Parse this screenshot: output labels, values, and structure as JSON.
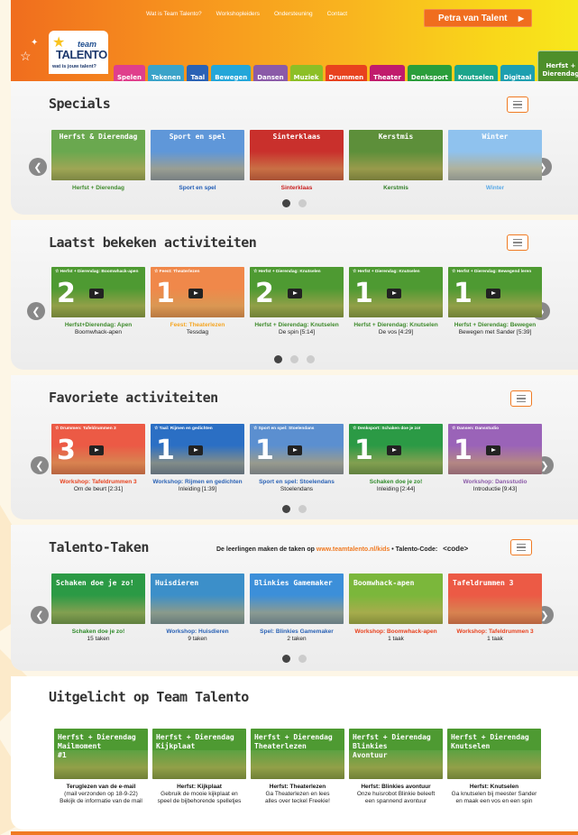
{
  "header": {
    "topnav": [
      "Wat is Team Talento?",
      "Workshopleiders",
      "Ondersteuning",
      "Contact"
    ],
    "user_button": "Petra van Talent",
    "logo": {
      "line1": "team",
      "line2": "TALENTO",
      "tagline": "wat is jouw talent?"
    },
    "tabs": [
      {
        "label": "Spelen",
        "color": "#e03f8c"
      },
      {
        "label": "Tekenen",
        "color": "#3aa3c9"
      },
      {
        "label": "Taal",
        "color": "#2a62b5"
      },
      {
        "label": "Bewegen",
        "color": "#23a6d9"
      },
      {
        "label": "Dansen",
        "color": "#8b5aa8"
      },
      {
        "label": "Muziek",
        "color": "#8cbf26"
      },
      {
        "label": "Drummen",
        "color": "#e8421e"
      },
      {
        "label": "Theater",
        "color": "#c11b6c"
      },
      {
        "label": "Denksport",
        "color": "#2a9e3b"
      },
      {
        "label": "Knutselen",
        "color": "#1ca58b"
      },
      {
        "label": "Digitaal",
        "color": "#1d9fb0"
      }
    ],
    "special_tab": {
      "line1": "Herfst +",
      "line2": "Dierendag",
      "color": "#4e8f2a"
    }
  },
  "sections": {
    "specials": {
      "title": "Specials",
      "cards": [
        {
          "thumb_title": "Herfst & Dierendag",
          "label": "Herfst + Dierendag",
          "color": "#3e8a2c",
          "bg": "#6aa84f"
        },
        {
          "thumb_title": "Sport en spel",
          "label": "Sport en spel",
          "color": "#1f5bb5",
          "bg": "#5f97d9"
        },
        {
          "thumb_title": "Sinterklaas",
          "label": "Sinterklaas",
          "color": "#c81d1d",
          "bg": "#c9302c"
        },
        {
          "thumb_title": "Kerstmis",
          "label": "Kerstmis",
          "color": "#2f7d25",
          "bg": "#5d8f3a"
        },
        {
          "thumb_title": "Winter",
          "label": "Winter",
          "color": "#5aa9e6",
          "bg": "#8fc2ee"
        }
      ]
    },
    "recent": {
      "title": "Laatst bekeken activiteiten",
      "cards": [
        {
          "sub": "☆ Herfst + Dierendag: Boomwhack-apen",
          "num": "2",
          "label": "Herfst+Dierendag: Apen",
          "detail": "Boomwhack-apen",
          "color": "#3e8a2c",
          "bg": "#4e9a32"
        },
        {
          "sub": "☆ Feest: Theaterlezen",
          "num": "1",
          "label": "Feest: Theaterlezen",
          "detail": "Tessdag",
          "color": "#f5a623",
          "bg": "#f0884a"
        },
        {
          "sub": "☆ Herfst + Dierendag: Knutselen",
          "num": "2",
          "label": "Herfst + Dierendag: Knutselen",
          "detail": "De spin [5:14]",
          "color": "#3e8a2c",
          "bg": "#4e9a32"
        },
        {
          "sub": "☆ Herfst + Dierendag: Knutselen",
          "num": "1",
          "label": "Herfst + Dierendag: Knutselen",
          "detail": "De vos [4:29]",
          "color": "#3e8a2c",
          "bg": "#4e9a32"
        },
        {
          "sub": "☆ Herfst + Dierendag: Bewegend leren",
          "num": "1",
          "label": "Herfst + Dierendag: Bewegen",
          "detail": "Bewegen met Sander [5:39]",
          "color": "#3e8a2c",
          "bg": "#4e9a32"
        }
      ]
    },
    "favorites": {
      "title": "Favoriete activiteiten",
      "cards": [
        {
          "sub": "☆ Drummen: Tafeldrummen 3",
          "num": "3",
          "label": "Workshop: Tafeldrummen 3",
          "detail": "Om de beurt [2:31]",
          "color": "#e8421e",
          "bg": "#ec5a45"
        },
        {
          "sub": "☆ Taal: Rijmen en gedichten",
          "num": "1",
          "label": "Workshop: Rijmen en gedichten",
          "detail": "Inleiding [1:39]",
          "color": "#2a62b5",
          "bg": "#2b6fc4"
        },
        {
          "sub": "☆ Sport en spel: Stoelendans",
          "num": "1",
          "label": "Sport en spel: Stoelendans",
          "detail": "Stoelendans",
          "color": "#2a62b5",
          "bg": "#5b8fd0"
        },
        {
          "sub": "☆ Denksport: Schaken doe je zo!",
          "num": "1",
          "label": "Schaken doe je zo!",
          "detail": "Inleiding [2:44]",
          "color": "#2f8a2a",
          "bg": "#2b9a45"
        },
        {
          "sub": "☆ Dansen: Dansstudio",
          "num": "1",
          "label": "Workshop: Dansstudio",
          "detail": "Introductie [9:43]",
          "color": "#8b5aa8",
          "bg": "#9a63b8"
        }
      ]
    },
    "tasks": {
      "title": "Talento-Taken",
      "info_text": "De leerlingen maken de taken op",
      "info_link": "www.teamtalento.nl/kids",
      "info_code_label": "• Talento-Code:",
      "info_code": "<code>",
      "cards": [
        {
          "thumb_title": "Schaken doe je zo!",
          "label": "Schaken doe je zo!",
          "detail": "15 taken",
          "color": "#2f8a2a",
          "bg": "#2b9a45"
        },
        {
          "thumb_title": "Huisdieren",
          "label": "Workshop: Huisdieren",
          "detail": "9 taken",
          "color": "#2a62b5",
          "bg": "#3c8fc9"
        },
        {
          "thumb_title": "Blinkies Gamemaker",
          "label": "Spel: Blinkies Gamemaker",
          "detail": "2 taken",
          "color": "#2a62b5",
          "bg": "#3c8fd9"
        },
        {
          "thumb_title": "Boomwhack-apen",
          "label": "Workshop: Boomwhack-apen",
          "detail": "1 taak",
          "color": "#e8421e",
          "bg": "#7bb73b"
        },
        {
          "thumb_title": "Tafeldrummen 3",
          "label": "Workshop: Tafeldrummen 3",
          "detail": "1 taak",
          "color": "#e8421e",
          "bg": "#ec5a45"
        }
      ]
    },
    "featured": {
      "title": "Uitgelicht op Team Talento",
      "cards": [
        {
          "t1": "Herfst + Dierendag",
          "t2": "Mailmoment",
          "t3": "#1",
          "label": "Teruglezen van de e-mail",
          "detail1": "(mail verzonden op 18-9-22)",
          "detail2": "Bekijk de informatie van de mail"
        },
        {
          "t1": "Herfst + Dierendag",
          "t2": "Kijkplaat",
          "t3": "",
          "label": "Herfst: Kijkplaat",
          "detail1": "Gebruik de mooie kijkplaat en",
          "detail2": "speel de bijbehorende spelletjes"
        },
        {
          "t1": "Herfst + Dierendag",
          "t2": "Theaterlezen",
          "t3": "",
          "label": "Herfst: Theaterlezen",
          "detail1": "Ga Theaterlezen en lees",
          "detail2": "alles over teckel Freekie!"
        },
        {
          "t1": "Herfst + Dierendag",
          "t2": "Blinkies",
          "t3": "Avontuur",
          "label": "Herfst: Blinkies avontuur",
          "detail1": "Onze huisrobot Blinkie beleeft",
          "detail2": "een spannend avontuur"
        },
        {
          "t1": "Herfst + Dierendag",
          "t2": "Knutselen",
          "t3": "",
          "label": "Herfst: Knutselen",
          "detail1": "Ga knutselen bij meester Sander",
          "detail2": "en maak een vos en een spin"
        }
      ]
    }
  },
  "icons": {
    "menu": "hamburger-icon",
    "prev": "chevron-left-icon",
    "next": "chevron-right-icon"
  }
}
